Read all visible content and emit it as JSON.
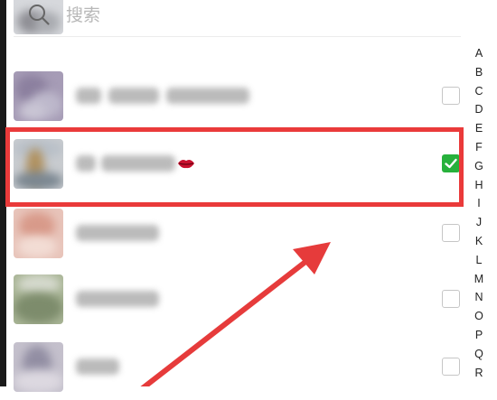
{
  "search": {
    "placeholder": "搜索",
    "icon": "search-icon"
  },
  "contacts": [
    {
      "checked": false,
      "avatar_colors": [
        "#d9dbe0",
        "#c7c9ce",
        "#8f8f95"
      ]
    },
    {
      "checked": false,
      "avatar_colors": [
        "#9c92ae",
        "#b8b4c6",
        "#7a6f90"
      ]
    },
    {
      "checked": true,
      "avatar_colors": [
        "#cfc3a8",
        "#a58a5e",
        "#6b7c88"
      ],
      "icon": "lips-icon"
    },
    {
      "checked": false,
      "avatar_colors": [
        "#e6b8ac",
        "#d79a8c",
        "#f0d6cc"
      ]
    },
    {
      "checked": false,
      "avatar_colors": [
        "#8fa07e",
        "#c0c7b4",
        "#6e7d61"
      ]
    },
    {
      "checked": false,
      "avatar_colors": [
        "#b6b4c4",
        "#8a8699",
        "#d8d4dc"
      ]
    }
  ],
  "alphabet": [
    "A",
    "B",
    "C",
    "D",
    "E",
    "F",
    "G",
    "H",
    "I",
    "J",
    "K",
    "L",
    "M",
    "N",
    "O",
    "P",
    "Q",
    "R"
  ],
  "colors": {
    "highlight": "#ea3a3a",
    "checkbox_checked": "#27b13c",
    "arrow": "#e63b3b"
  }
}
